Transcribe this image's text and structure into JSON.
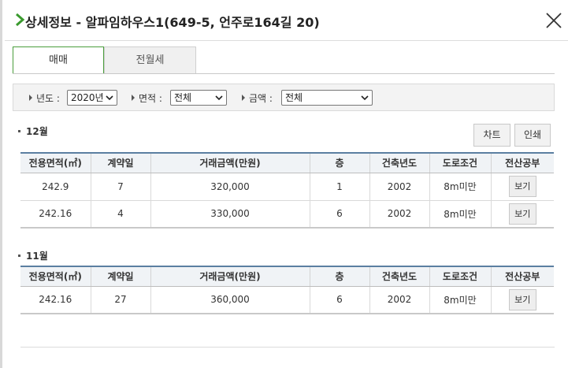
{
  "header": {
    "title": "상세정보 - 알파임하우스1(649-5, 언주로164길 20)"
  },
  "tabs": [
    {
      "label": "매매",
      "active": true
    },
    {
      "label": "전월세",
      "active": false
    }
  ],
  "filters": {
    "year": {
      "label": "년도 :",
      "value": "2020년"
    },
    "area": {
      "label": "면적 :",
      "value": "전체"
    },
    "amount": {
      "label": "금액 :",
      "value": "전체"
    }
  },
  "actions": {
    "chart_label": "차트",
    "print_label": "인쇄"
  },
  "columns": [
    "전용면적(㎡)",
    "계약일",
    "거래금액(만원)",
    "층",
    "건축년도",
    "도로조건",
    "전산공부"
  ],
  "sections": [
    {
      "title": "12월",
      "rows": [
        {
          "area": "242.9",
          "day": "7",
          "price": "320,000",
          "floor": "1",
          "built": "2002",
          "road": "8m미만",
          "view": "보기"
        },
        {
          "area": "242.16",
          "day": "4",
          "price": "330,000",
          "floor": "6",
          "built": "2002",
          "road": "8m미만",
          "view": "보기"
        }
      ]
    },
    {
      "title": "11월",
      "rows": [
        {
          "area": "242.16",
          "day": "27",
          "price": "360,000",
          "floor": "6",
          "built": "2002",
          "road": "8m미만",
          "view": "보기"
        }
      ]
    }
  ],
  "colors": {
    "accent_green": "#4a9e3c",
    "table_header_border": "#5b7fa1"
  },
  "icons": {
    "title_marker": "chevron-right-icon",
    "close": "close-icon",
    "dropdown": "chevron-down-icon"
  }
}
